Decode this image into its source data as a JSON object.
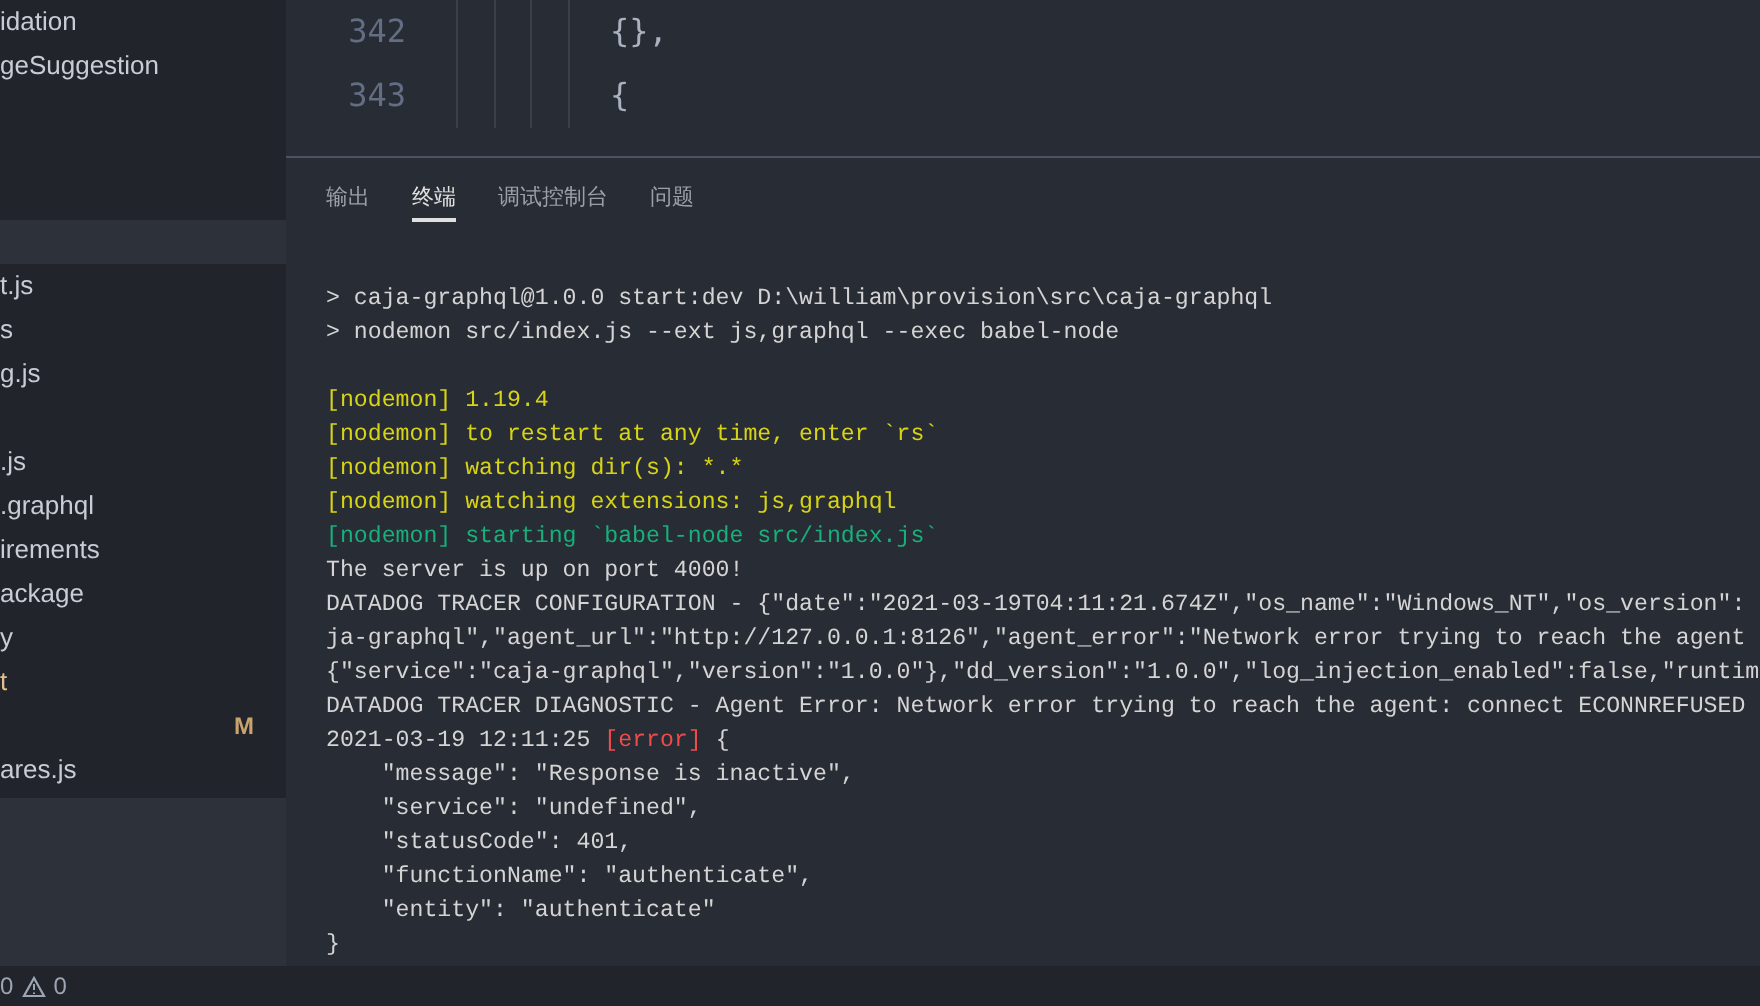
{
  "sidebar": {
    "items": [
      {
        "kind": "file",
        "name": "idation",
        "modified": false
      },
      {
        "kind": "file",
        "name": "geSuggestion",
        "modified": false
      },
      {
        "kind": "blank"
      },
      {
        "kind": "blank"
      },
      {
        "kind": "blank"
      },
      {
        "kind": "selected"
      },
      {
        "kind": "file",
        "name": "t.js",
        "modified": false
      },
      {
        "kind": "file",
        "name": "s",
        "modified": false
      },
      {
        "kind": "file",
        "name": "g.js",
        "modified": false
      },
      {
        "kind": "blank"
      },
      {
        "kind": "file",
        "name": ".js",
        "modified": false
      },
      {
        "kind": "file",
        "name": ".graphql",
        "modified": false
      },
      {
        "kind": "file",
        "name": "irements",
        "modified": false
      },
      {
        "kind": "file",
        "name": "ackage",
        "modified": false
      },
      {
        "kind": "file",
        "name": "y",
        "modified": false
      },
      {
        "kind": "file",
        "name": "t",
        "modified": true
      },
      {
        "kind": "badge",
        "badge": "M"
      },
      {
        "kind": "file",
        "name": "ares.js",
        "modified": false
      }
    ]
  },
  "editor": {
    "lines": [
      {
        "number": "342",
        "code": "{},"
      },
      {
        "number": "343",
        "code": "{"
      }
    ]
  },
  "panel": {
    "tabs": [
      {
        "label": "输出",
        "selected": false
      },
      {
        "label": "终端",
        "selected": true
      },
      {
        "label": "调试控制台",
        "selected": false
      },
      {
        "label": "问题",
        "selected": false
      }
    ],
    "terminal": [
      {
        "kind": "text",
        "segments": [
          {
            "color": "#d4d4d4",
            "text": "> caja-graphql@1.0.0 start:dev D:\\william\\provision\\src\\caja-graphql"
          }
        ]
      },
      {
        "kind": "text",
        "segments": [
          {
            "color": "#d4d4d4",
            "text": "> nodemon src/index.js --ext js,graphql --exec babel-node"
          }
        ]
      },
      {
        "kind": "blank"
      },
      {
        "kind": "text",
        "segments": [
          {
            "color": "#d7d416",
            "text": "[nodemon] 1.19.4"
          }
        ]
      },
      {
        "kind": "text",
        "segments": [
          {
            "color": "#d7d416",
            "text": "[nodemon] to restart at any time, enter `rs`"
          }
        ]
      },
      {
        "kind": "text",
        "segments": [
          {
            "color": "#d7d416",
            "text": "[nodemon] watching dir(s): *.*"
          }
        ]
      },
      {
        "kind": "text",
        "segments": [
          {
            "color": "#d7d416",
            "text": "[nodemon] watching extensions: js,graphql"
          }
        ]
      },
      {
        "kind": "text",
        "segments": [
          {
            "color": "#17b07a",
            "text": "[nodemon] starting `babel-node src/index.js`"
          }
        ]
      },
      {
        "kind": "text",
        "segments": [
          {
            "color": "#d4d4d4",
            "text": "The server is up on port 4000!"
          }
        ]
      },
      {
        "kind": "text",
        "segments": [
          {
            "color": "#d4d4d4",
            "text": "DATADOG TRACER CONFIGURATION - {\"date\":\"2021-03-19T04:11:21.674Z\",\"os_name\":\"Windows_NT\",\"os_version\":"
          }
        ]
      },
      {
        "kind": "text",
        "segments": [
          {
            "color": "#d4d4d4",
            "text": "ja-graphql\",\"agent_url\":\"http://127.0.0.1:8126\",\"agent_error\":\"Network error trying to reach the agent"
          }
        ]
      },
      {
        "kind": "text",
        "segments": [
          {
            "color": "#d4d4d4",
            "text": "{\"service\":\"caja-graphql\",\"version\":\"1.0.0\"},\"dd_version\":\"1.0.0\",\"log_injection_enabled\":false,\"runtim"
          }
        ]
      },
      {
        "kind": "text",
        "segments": [
          {
            "color": "#d4d4d4",
            "text": "DATADOG TRACER DIAGNOSTIC - Agent Error: Network error trying to reach the agent: connect ECONNREFUSED"
          }
        ]
      },
      {
        "kind": "text",
        "segments": [
          {
            "color": "#d4d4d4",
            "text": "2021-03-19 12:11:25 "
          },
          {
            "color": "#f14c4c",
            "text": "[error]"
          },
          {
            "color": "#d4d4d4",
            "text": " {"
          }
        ]
      },
      {
        "kind": "text",
        "segments": [
          {
            "color": "#d4d4d4",
            "text": "    \"message\": \"Response is inactive\","
          }
        ]
      },
      {
        "kind": "text",
        "segments": [
          {
            "color": "#d4d4d4",
            "text": "    \"service\": \"undefined\","
          }
        ]
      },
      {
        "kind": "text",
        "segments": [
          {
            "color": "#d4d4d4",
            "text": "    \"statusCode\": 401,"
          }
        ]
      },
      {
        "kind": "text",
        "segments": [
          {
            "color": "#d4d4d4",
            "text": "    \"functionName\": \"authenticate\","
          }
        ]
      },
      {
        "kind": "text",
        "segments": [
          {
            "color": "#d4d4d4",
            "text": "    \"entity\": \"authenticate\""
          }
        ]
      },
      {
        "kind": "text",
        "segments": [
          {
            "color": "#d4d4d4",
            "text": "}"
          }
        ]
      }
    ]
  },
  "status_bar": {
    "errors": "0",
    "warnings": "0"
  }
}
